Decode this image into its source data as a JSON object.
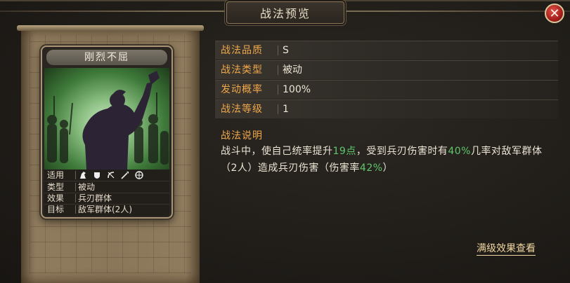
{
  "window": {
    "title": "战法预览",
    "close_label": "✕"
  },
  "card": {
    "name": "刚烈不屈",
    "stats": [
      {
        "key": "适用",
        "icons": [
          "cavalry-icon",
          "shield-icon",
          "bow-icon",
          "spear-icon",
          "wheel-icon"
        ]
      },
      {
        "key": "类型",
        "value": "被动"
      },
      {
        "key": "效果",
        "value": "兵刃群体"
      },
      {
        "key": "目标",
        "value": "敌军群体(2人)"
      }
    ]
  },
  "info": [
    {
      "key": "战法品质",
      "value": "S"
    },
    {
      "key": "战法类型",
      "value": "被动"
    },
    {
      "key": "发动概率",
      "value": "100%"
    },
    {
      "key": "战法等级",
      "value": "1"
    }
  ],
  "description": {
    "title": "战法说明",
    "part1": "战斗中，使自己统率提升",
    "hl1": "19点",
    "part2": "，受到兵刃伤害时有",
    "hl2": "40%",
    "part3": "几率对敌军群体（2人）造成兵刃伤害（伤害率",
    "hl3": "42%",
    "part4": "）"
  },
  "full_effect_link": "满级效果查看",
  "colors": {
    "accent": "#f0a84a",
    "highlight": "#5fc86c",
    "close": "#a51e1a"
  }
}
